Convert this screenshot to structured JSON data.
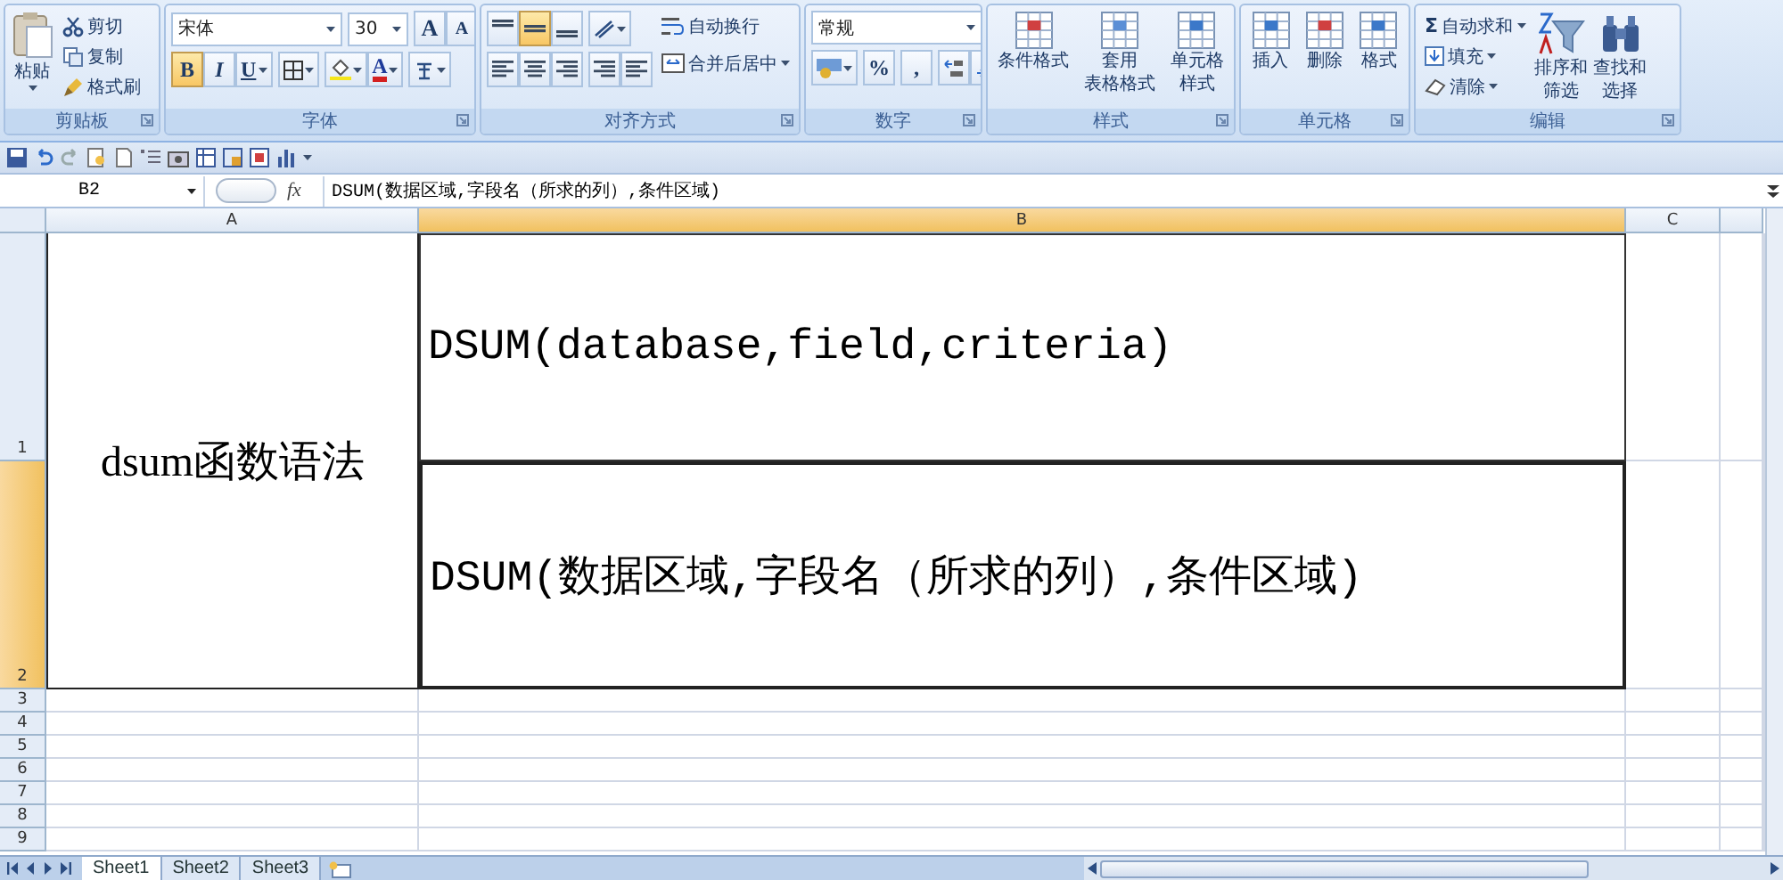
{
  "ribbon": [
    {
      "kind": "clipboard",
      "title": "剪贴板",
      "paste": "粘贴",
      "actions": [
        "剪切",
        "复制",
        "格式刷"
      ]
    },
    {
      "kind": "font",
      "title": "字体",
      "font": "宋体",
      "size": "30",
      "grow": "A",
      "shrink": "A",
      "styles": [
        {
          "label": "B",
          "selected": true
        },
        {
          "label": "I",
          "selected": false
        },
        {
          "label": "U",
          "selected": false
        }
      ],
      "font_color": "A"
    },
    {
      "kind": "alignment",
      "title": "对齐方式",
      "vertical": [
        {
          "selected": false
        },
        {
          "selected": true
        },
        {
          "selected": false
        }
      ],
      "wrap": "自动换行",
      "merge": "合并后居中"
    },
    {
      "kind": "number",
      "title": "数字",
      "format": "常规",
      "percent": "%",
      "comma": ","
    },
    {
      "kind": "styles",
      "title": "样式",
      "buttons": [
        {
          "lines": [
            "条件格式"
          ]
        },
        {
          "lines": [
            "套用",
            "表格格式"
          ]
        },
        {
          "lines": [
            "单元格",
            "样式"
          ]
        }
      ]
    },
    {
      "kind": "cells",
      "title": "单元格",
      "buttons": [
        {
          "lines": [
            "插入"
          ]
        },
        {
          "lines": [
            "删除"
          ]
        },
        {
          "lines": [
            "格式"
          ]
        }
      ]
    },
    {
      "kind": "editing",
      "title": "编辑",
      "sum_symbol": "Σ",
      "actions": [
        "自动求和",
        "填充",
        "清除"
      ],
      "buttons": [
        {
          "lines": [
            "排序和",
            "筛选"
          ]
        },
        {
          "lines": [
            "查找和",
            "选择"
          ]
        }
      ]
    }
  ],
  "formula_bar": {
    "name_box": "B2",
    "fx": "fx",
    "formula": "DSUM(数据区域,字段名（所求的列）,条件区域)"
  },
  "sheet": {
    "columns": [
      {
        "label": "A",
        "selected": false
      },
      {
        "label": "B",
        "selected": true
      },
      {
        "label": "C",
        "selected": false
      }
    ],
    "rows": [
      {
        "label": "1",
        "selected": false
      },
      {
        "label": "2",
        "selected": true
      },
      {
        "label": "3",
        "selected": false
      },
      {
        "label": "4",
        "selected": false
      },
      {
        "label": "5",
        "selected": false
      },
      {
        "label": "6",
        "selected": false
      },
      {
        "label": "7",
        "selected": false
      },
      {
        "label": "8",
        "selected": false
      },
      {
        "label": "9",
        "selected": false
      }
    ],
    "a1": "dsum函数语法",
    "b_cells": [
      {
        "text": "DSUM(database,field,criteria)",
        "selected": false
      },
      {
        "text": "DSUM(数据区域,字段名（所求的列）,条件区域)",
        "selected": true
      }
    ]
  },
  "sheet_tabs": [
    {
      "label": "Sheet1",
      "selected": true
    },
    {
      "label": "Sheet2",
      "selected": false
    },
    {
      "label": "Sheet3",
      "selected": false
    }
  ]
}
